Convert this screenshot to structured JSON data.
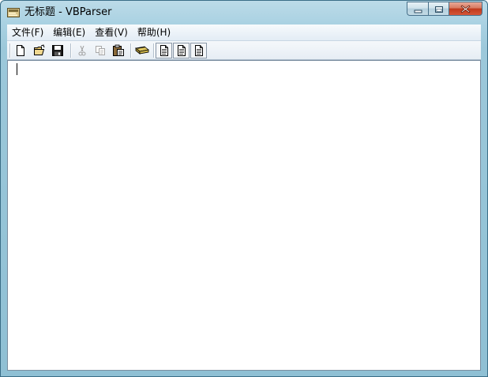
{
  "window": {
    "title": "无标题 - VBParser"
  },
  "menubar": {
    "items": [
      {
        "label": "文件(F)"
      },
      {
        "label": "编辑(E)"
      },
      {
        "label": "查看(V)"
      },
      {
        "label": "帮助(H)"
      }
    ]
  },
  "toolbar": {
    "buttons": [
      {
        "icon": "new-file-icon",
        "enabled": true
      },
      {
        "icon": "open-folder-icon",
        "enabled": true
      },
      {
        "icon": "save-icon",
        "enabled": true
      },
      {
        "icon": "cut-icon",
        "enabled": false
      },
      {
        "icon": "copy-icon",
        "enabled": false
      },
      {
        "icon": "paste-icon",
        "enabled": true
      },
      {
        "icon": "parse-icon",
        "enabled": true
      },
      {
        "icon": "view-document-icon",
        "enabled": true
      },
      {
        "icon": "view-document-icon",
        "enabled": true
      },
      {
        "icon": "view-document-icon",
        "enabled": true
      }
    ]
  },
  "editor": {
    "text": ""
  },
  "colors": {
    "frame_glass": "#9cc8da",
    "close_button": "#c0391b",
    "client_background": "#ffffff"
  }
}
